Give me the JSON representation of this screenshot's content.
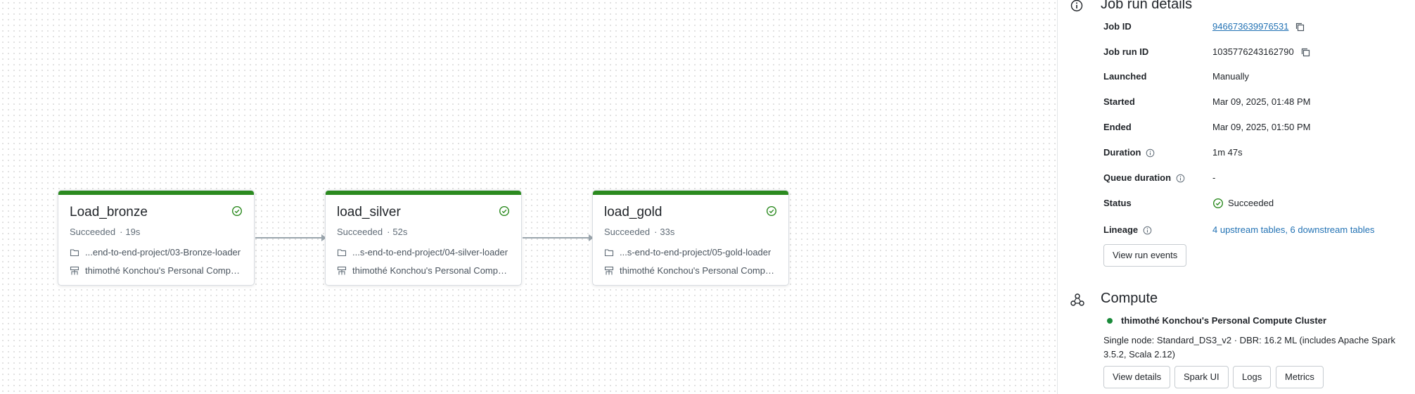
{
  "tasks": [
    {
      "name": "Load_bronze",
      "status": "Succeeded",
      "duration": "19s",
      "path": "...end-to-end-project/03-Bronze-loader",
      "cluster": "thimothé Konchou's Personal Comput..."
    },
    {
      "name": "load_silver",
      "status": "Succeeded",
      "duration": "52s",
      "path": "...s-end-to-end-project/04-silver-loader",
      "cluster": "thimothé Konchou's Personal Comput..."
    },
    {
      "name": "load_gold",
      "status": "Succeeded",
      "duration": "33s",
      "path": "...s-end-to-end-project/05-gold-loader",
      "cluster": "thimothé Konchou's Personal Comput..."
    }
  ],
  "details": {
    "title": "Job run details",
    "job_id_label": "Job ID",
    "job_id": "946673639976531",
    "job_run_id_label": "Job run ID",
    "job_run_id": "1035776243162790",
    "launched_label": "Launched",
    "launched": "Manually",
    "started_label": "Started",
    "started": "Mar 09, 2025, 01:48 PM",
    "ended_label": "Ended",
    "ended": "Mar 09, 2025, 01:50 PM",
    "duration_label": "Duration",
    "duration": "1m 47s",
    "queue_label": "Queue duration",
    "queue": "-",
    "status_label": "Status",
    "status": "Succeeded",
    "lineage_label": "Lineage",
    "lineage": "4 upstream tables, 6 downstream tables",
    "view_events": "View run events"
  },
  "compute": {
    "title": "Compute",
    "cluster_name": "thimothé Konchou's Personal Compute Cluster",
    "cluster_desc": "Single node: Standard_DS3_v2 · DBR: 16.2 ML (includes Apache Spark 3.5.2, Scala 2.12)",
    "buttons": {
      "view_details": "View details",
      "spark_ui": "Spark UI",
      "logs": "Logs",
      "metrics": "Metrics"
    }
  },
  "colors": {
    "success": "#2b8a1f",
    "link": "#2272b4",
    "running_dot": "#1a8a3a"
  },
  "icons": [
    "check-circle-icon",
    "folder-icon",
    "cluster-icon",
    "info-icon",
    "copy-icon",
    "compute-icon"
  ]
}
